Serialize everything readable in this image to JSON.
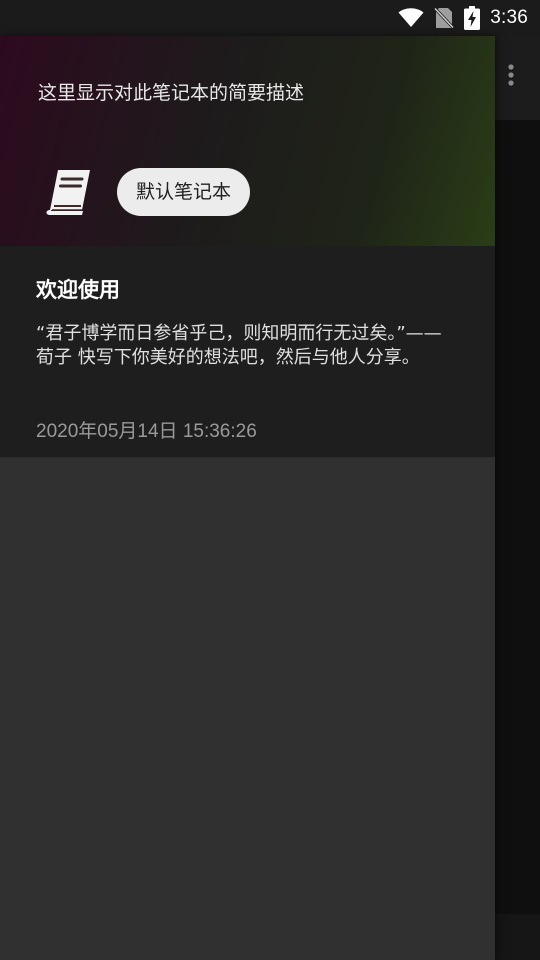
{
  "status_bar": {
    "time": "3:36",
    "icons": [
      "wifi-icon",
      "no-sim-icon",
      "battery-charging-icon"
    ]
  },
  "drawer": {
    "header": {
      "description": "这里显示对此笔记本的简要描述",
      "icon": "book-icon",
      "notebook_name": "默认笔记本"
    },
    "notes": [
      {
        "title": "欢迎使用",
        "content": "“君子博学而日参省乎己，则知明而行无过矣。”——荀子 快写下你美好的想法吧，然后与他人分享。",
        "time": "2020年05月14日 15:36:26"
      }
    ]
  },
  "background_app": {
    "menu_icon": "more-vert-icon"
  }
}
